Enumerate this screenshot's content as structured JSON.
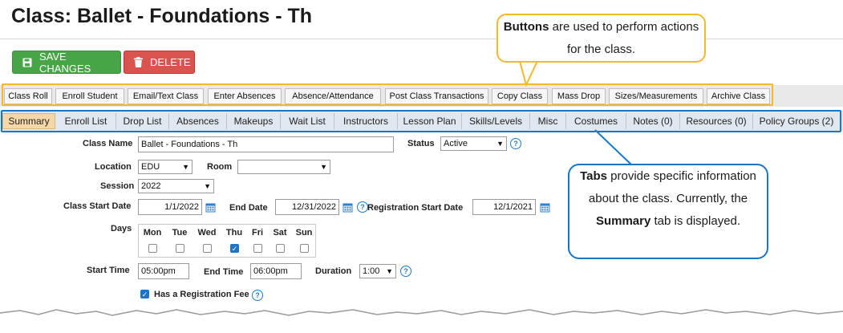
{
  "page_title": "Class: Ballet - Foundations - Th",
  "main_buttons": {
    "save": "SAVE CHANGES",
    "delete": "DELETE"
  },
  "action_buttons": [
    "Class Roll",
    "Enroll Student",
    "Email/Text Class",
    "Enter Absences",
    "Absence/Attendance",
    "Post Class Transactions",
    "Copy Class",
    "Mass Drop",
    "Sizes/Measurements",
    "Archive Class"
  ],
  "tabs": [
    "Summary",
    "Enroll List",
    "Drop List",
    "Absences",
    "Makeups",
    "Wait List",
    "Instructors",
    "Lesson Plan",
    "Skills/Levels",
    "Misc",
    "Costumes",
    "Notes (0)",
    "Resources (0)",
    "Policy Groups (2)"
  ],
  "form": {
    "class_name_label": "Class Name",
    "class_name_value": "Ballet - Foundations - Th",
    "status_label": "Status",
    "status_value": "Active",
    "location_label": "Location",
    "location_value": "EDU",
    "room_label": "Room",
    "room_value": "",
    "session_label": "Session",
    "session_value": "2022",
    "start_date_label": "Class Start Date",
    "start_date_value": "1/1/2022",
    "end_date_label": "End Date",
    "end_date_value": "12/31/2022",
    "reg_start_label": "Registration Start Date",
    "reg_start_value": "12/1/2021",
    "days_label": "Days",
    "days": [
      {
        "name": "Mon",
        "checked": false
      },
      {
        "name": "Tue",
        "checked": false
      },
      {
        "name": "Wed",
        "checked": false
      },
      {
        "name": "Thu",
        "checked": true
      },
      {
        "name": "Fri",
        "checked": false
      },
      {
        "name": "Sat",
        "checked": false
      },
      {
        "name": "Sun",
        "checked": false
      }
    ],
    "start_time_label": "Start Time",
    "start_time_value": "05:00pm",
    "end_time_label": "End Time",
    "end_time_value": "06:00pm",
    "duration_label": "Duration",
    "duration_value": "1:00",
    "reg_fee_label": "Has a Registration Fee",
    "reg_fee_checked": true
  },
  "callouts": {
    "buttons": {
      "bold": "Buttons",
      "text": " are used to perform actions for the class."
    },
    "tabs": {
      "bold1": "Tabs",
      "text1": " provide specific information about the class. Currently, the ",
      "bold2": "Summary",
      "text2": " tab is displayed."
    }
  },
  "colors": {
    "save": "#47a447",
    "delete": "#d9534f",
    "buttons_callout": "#f4b92b",
    "tabs_callout": "#1578c4",
    "active_tab": "#f6d7a8"
  }
}
